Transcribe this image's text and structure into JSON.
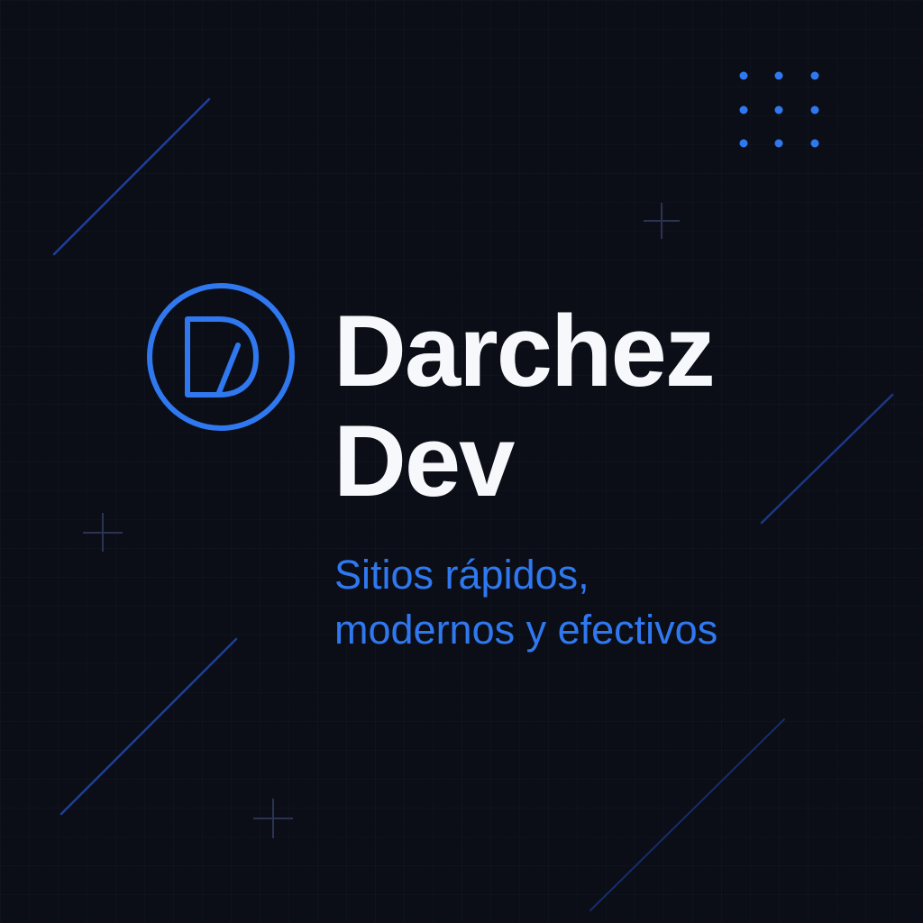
{
  "brand": {
    "name_line1": "Darchez",
    "name_line2": "Dev",
    "logo_icon": "d-monogram-circle-icon"
  },
  "tagline": {
    "line1": "Sitios rápidos,",
    "line2": "modernos y efectivos"
  },
  "colors": {
    "background": "#0b0e16",
    "accent": "#2f78f0",
    "text": "#f7f8fb",
    "decor_line": "#1e3f9a",
    "decor_cross": "#2a3450"
  }
}
